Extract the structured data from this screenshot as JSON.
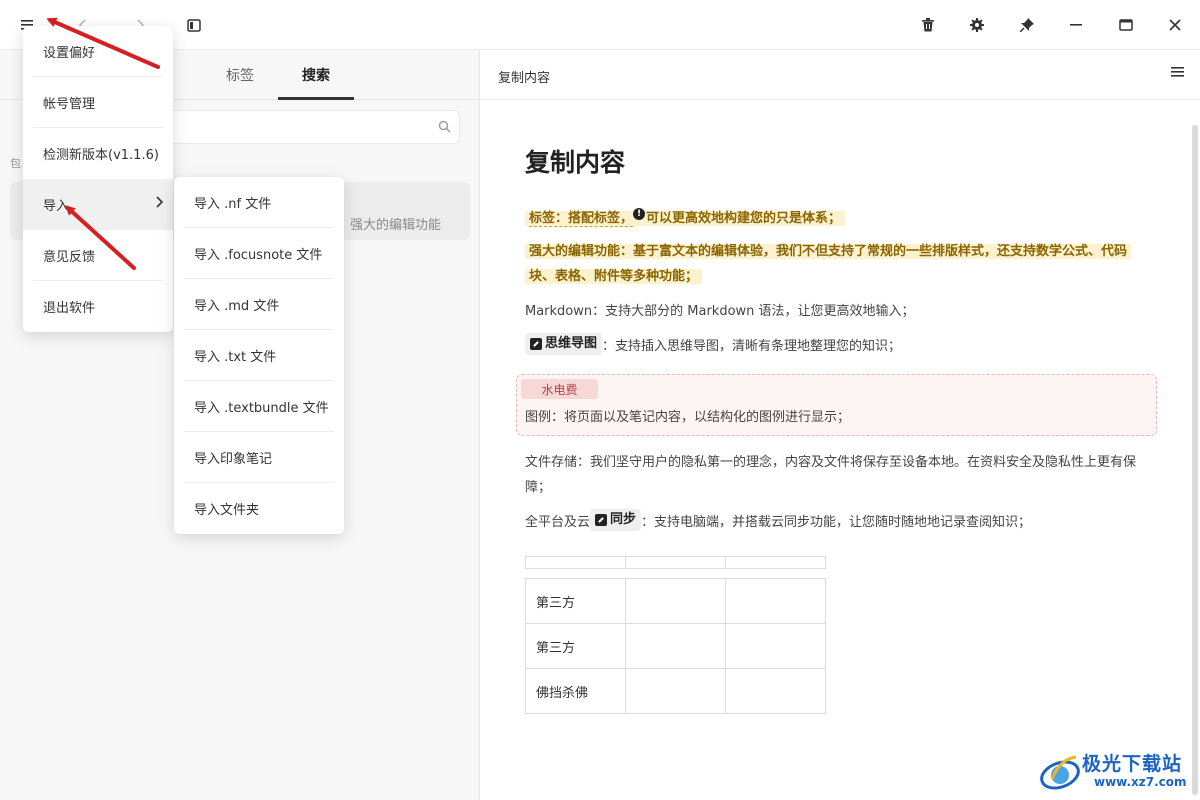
{
  "titlebar": {
    "icons": [
      "hamburger-icon",
      "back-icon",
      "forward-icon",
      "sidebar-toggle-icon",
      "trash-icon",
      "gear-icon",
      "pin-icon",
      "minimize-icon",
      "maximize-icon",
      "close-icon"
    ]
  },
  "left_pane": {
    "tabs": [
      {
        "label": "标签",
        "active": false
      },
      {
        "label": "搜索",
        "active": true
      }
    ],
    "search": {
      "value": "",
      "placeholder": ""
    },
    "cut_label": "包",
    "note_snippet": "强大的编辑功能"
  },
  "main_menu": {
    "items": [
      {
        "label": "设置偏好"
      },
      {
        "label": "帐号管理"
      },
      {
        "label": "检测新版本(v1.1.6)"
      },
      {
        "label": "导入"
      },
      {
        "label": "意见反馈"
      },
      {
        "label": "退出软件"
      }
    ]
  },
  "import_submenu": {
    "items": [
      {
        "label": "导入 .nf 文件"
      },
      {
        "label": "导入 .focusnote 文件"
      },
      {
        "label": "导入 .md 文件"
      },
      {
        "label": "导入 .txt 文件"
      },
      {
        "label": "导入 .textbundle 文件"
      },
      {
        "label": "导入印象笔记"
      },
      {
        "label": "导入文件夹"
      }
    ]
  },
  "right_pane": {
    "header_title": "复制内容",
    "doc": {
      "title": "复制内容",
      "line1_a": "标签：搭配标签，",
      "line1_badge": "!",
      "line1_b": "可以更高效地构建您的只是体系；",
      "line2": "强大的编辑功能：基于富文本的编辑体验，我们不但支持了常规的一些排版样式，还支持数学公式、代码块、表格、附件等多种功能；",
      "line3": "Markdown：支持大部分的 Markdown 语法，让您更高效地输入；",
      "mindmap_chip": "思维导图",
      "line4": "：支持插入思维导图，清晰有条理地整理您的知识；",
      "tag_pill": "水电费",
      "legend_desc": "图例：将页面以及笔记内容，以结构化的图例进行显示；",
      "storage": "文件存储：我们坚守用户的隐私第一的理念，内容及文件将保存至设备本地。在资料安全及隐私性上更有保障；",
      "sync_prefix": "全平台及云",
      "sync_chip": "同步",
      "sync_suffix": "：支持电脑端，并搭载云同步功能，让您随时随地地记录查阅知识；",
      "table_rows": [
        [
          "第三方",
          "",
          ""
        ],
        [
          "第三方",
          "",
          ""
        ],
        [
          "佛挡杀佛",
          "",
          ""
        ]
      ]
    }
  },
  "watermark": {
    "title": "极光下载站",
    "url": "www.xz7.com"
  },
  "colors": {
    "highlight_bg": "#fdf2cf",
    "highlight_text": "#8a6500",
    "tag_bg": "#f8d7d7",
    "annotation_arrow": "#d62020",
    "watermark_blue": "#1c64c4"
  }
}
